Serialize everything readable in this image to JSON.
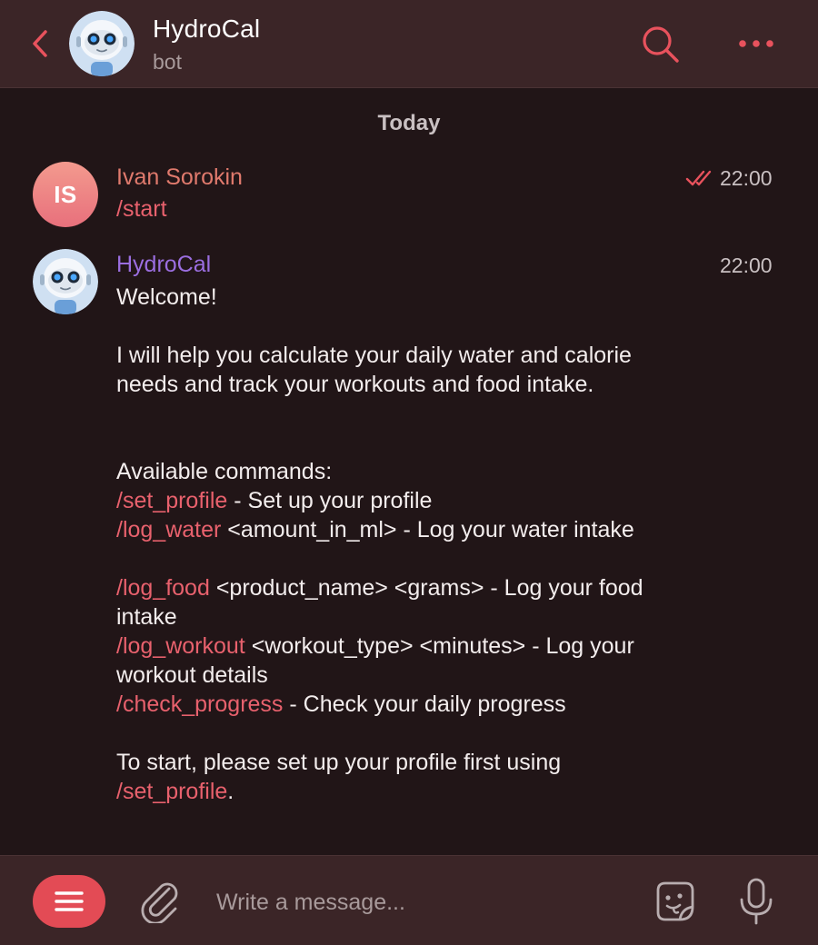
{
  "header": {
    "title": "HydroCal",
    "subtitle": "bot",
    "back_icon": "chevron-left-icon",
    "search_icon": "search-icon",
    "more_icon": "more-dots-icon"
  },
  "date_separator": "Today",
  "messages": [
    {
      "sender": "Ivan Sorokin",
      "avatar_initials": "IS",
      "text": "/start",
      "time": "22:00",
      "status": "read"
    },
    {
      "sender": "HydroCal",
      "time": "22:00",
      "lines": {
        "welcome": "Welcome!",
        "intro": "I will help you calculate your daily water and calorie needs and track your workouts and food intake.",
        "commands_header": "Available commands:",
        "cmd_set_profile": "/set_profile",
        "desc_set_profile": " - Set up your profile",
        "cmd_log_water": "/log_water",
        "desc_log_water": " <amount_in_ml> - Log your water intake",
        "cmd_log_food": "/log_food",
        "desc_log_food": " <product_name> <grams> - Log your food intake",
        "cmd_log_workout": "/log_workout",
        "desc_log_workout": " <workout_type> <minutes> - Log your workout details",
        "cmd_check_progress": "/check_progress",
        "desc_check_progress": " - Check your daily progress",
        "outro_start": "To start, please set up your profile first using ",
        "outro_cmd": "/set_profile",
        "outro_end": "."
      }
    }
  ],
  "composer": {
    "placeholder": "Write a message...",
    "menu_icon": "menu-icon",
    "attach_icon": "paperclip-icon",
    "sticker_icon": "sticker-icon",
    "mic_icon": "microphone-icon"
  },
  "colors": {
    "background": "#211517",
    "header": "#3b2527",
    "accent": "#e34b55",
    "link": "#e8616d",
    "user_name": "#e07a6d",
    "bot_name": "#9b6ee0"
  }
}
